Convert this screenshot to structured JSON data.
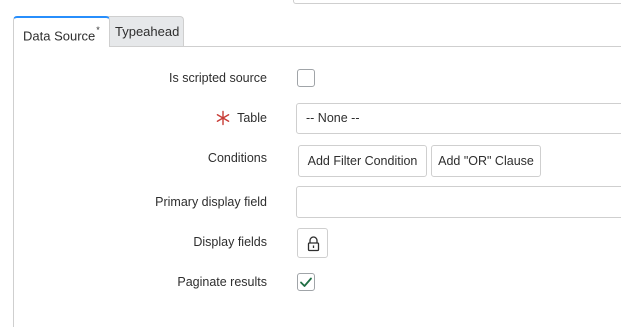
{
  "tabs": [
    {
      "label": "Data Source",
      "mark": "*",
      "active": true
    },
    {
      "label": "Typeahead",
      "active": false
    }
  ],
  "form": {
    "is_scripted_source": {
      "label": "Is scripted source",
      "checked": false
    },
    "table": {
      "label": "Table",
      "value": "-- None --",
      "mandatory": true
    },
    "conditions": {
      "label": "Conditions",
      "add_filter_label": "Add Filter Condition",
      "add_or_label": "Add \"OR\" Clause"
    },
    "primary_display_field": {
      "label": "Primary display field",
      "value": ""
    },
    "display_fields": {
      "label": "Display fields",
      "icon": "lock-icon"
    },
    "paginate_results": {
      "label": "Paginate results",
      "checked": true
    }
  },
  "colors": {
    "active_tab_accent": "#278efc",
    "mandatory": "#c83c36",
    "check": "#1f6e43"
  }
}
